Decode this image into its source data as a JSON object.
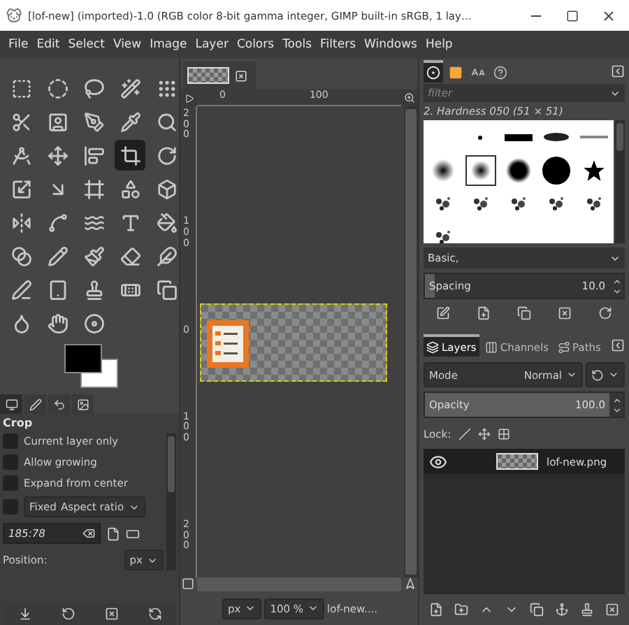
{
  "window": {
    "title": "[lof-new] (imported)-1.0 (RGB color 8-bit gamma integer, GIMP built-in sRGB, 1 lay…"
  },
  "menu": [
    "File",
    "Edit",
    "Select",
    "View",
    "Image",
    "Layer",
    "Colors",
    "Tools",
    "Filters",
    "Windows",
    "Help"
  ],
  "toolbox": {
    "tools": [
      {
        "selected": false
      },
      {
        "selected": false
      },
      {
        "selected": false
      },
      {
        "selected": false
      },
      {
        "selected": false
      },
      {
        "selected": false
      },
      {
        "selected": false
      },
      {
        "selected": false
      },
      {
        "selected": false
      },
      {
        "selected": false
      },
      {
        "selected": false
      },
      {
        "selected": false
      },
      {
        "selected": false
      },
      {
        "selected": true
      },
      {
        "selected": false
      },
      {
        "selected": false
      },
      {
        "selected": false
      },
      {
        "selected": false
      },
      {
        "selected": false
      },
      {
        "selected": false
      },
      {
        "selected": false
      },
      {
        "selected": false
      },
      {
        "selected": false
      },
      {
        "selected": false
      },
      {
        "selected": false
      },
      {
        "selected": false
      },
      {
        "selected": false
      },
      {
        "selected": false
      },
      {
        "selected": false
      },
      {
        "selected": false
      },
      {
        "selected": false
      },
      {
        "selected": false
      },
      {
        "selected": false
      },
      {
        "selected": false
      },
      {
        "selected": false
      },
      {
        "selected": false
      },
      {
        "selected": false
      },
      {
        "selected": false
      }
    ]
  },
  "tool_options": {
    "title": "Crop",
    "options": [
      {
        "label": "Current layer only",
        "checked": false
      },
      {
        "label": "Allow growing",
        "checked": false
      },
      {
        "label": "Expand from center",
        "checked": false
      }
    ],
    "fixed": {
      "label": "Fixed",
      "checked": false,
      "value": "Aspect ratio"
    },
    "ratio": "185:78",
    "position": {
      "label": "Position:",
      "unit": "px"
    }
  },
  "canvas": {
    "hruler": [
      "0",
      "100"
    ],
    "vruler": [
      "200",
      "100",
      "0",
      "100",
      "200"
    ],
    "status": {
      "unit": "px",
      "zoom": "100 %",
      "name": "lof-new...."
    }
  },
  "brushes": {
    "filter_placeholder": "filter",
    "brush_name": "2. Hardness 050 (51 × 51)",
    "tag": "Basic,",
    "spacing": {
      "label": "Spacing",
      "value": "10.0",
      "level": 0.05
    }
  },
  "layers": {
    "tabs": [
      {
        "label": "Layers",
        "selected": true
      },
      {
        "label": "Channels",
        "selected": false
      },
      {
        "label": "Paths",
        "selected": false
      }
    ],
    "mode": {
      "label": "Mode",
      "value": "Normal"
    },
    "opacity": {
      "label": "Opacity",
      "value": "100.0",
      "level": 1
    },
    "lock_label": "Lock:",
    "items": [
      {
        "name": "lof-new.png",
        "visible": true
      }
    ]
  }
}
